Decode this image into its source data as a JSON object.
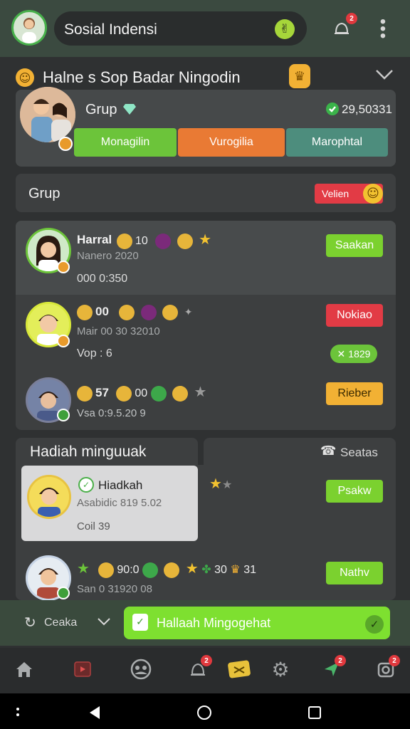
{
  "header": {
    "title": "Sosial Indensi",
    "notification_count": "2",
    "badge_glyph": "✌"
  },
  "featured": {
    "title": "Halne s Sop Badar Ningodin",
    "group_label": "Grup",
    "points": "29,50331",
    "buttons": [
      "Monagilin",
      "Vurogilia",
      "Marophtal"
    ]
  },
  "group_header": {
    "title": "Grup",
    "action_label": "Velien"
  },
  "members": [
    {
      "name": "Harral",
      "stat": "10",
      "sub": "Nanero 2020",
      "meta": "000 0:350",
      "button": "Saakan",
      "button_color": "#7bd12f"
    },
    {
      "name": "00",
      "stat": "",
      "sub": "Mair 00 30 32010",
      "meta": "Vop : 6",
      "button": "Nokiao",
      "button_color": "#e23b45",
      "extra_button": "1829"
    },
    {
      "name": "57",
      "stat": "00",
      "sub": "Vsa 0:9.5.20 9",
      "meta": "",
      "button": "Rieber",
      "button_color": "#f2b134"
    }
  ],
  "gifts": {
    "tab_active": "Hadiah minguuak",
    "tab_other": "Seatas",
    "card": {
      "name": "Hiadkah",
      "sub": "Asabidic 819 5.02",
      "meta": "Coil 39"
    },
    "card_button": "Psakw",
    "row": {
      "stat1": "90:0",
      "stat2": "30",
      "stat3": "31",
      "sub": "San 0 31920 08",
      "button": "Nathv"
    }
  },
  "action_bar": {
    "left_label": "Ceaka",
    "primary_label": "Hallaah Mingogehat"
  },
  "bottom_nav": [
    "home-icon",
    "video-icon",
    "people-icon",
    "bell-icon",
    "ticket-icon",
    "gear-icon",
    "pin-icon",
    "camera-icon"
  ],
  "nav_badges": {
    "bell": "2",
    "pin": "2",
    "camera": "2"
  },
  "colors": {
    "green": "#7bd12f",
    "orange": "#e97a34",
    "teal": "#4d8d7d",
    "red": "#e23b45",
    "yellow": "#f2b134"
  }
}
